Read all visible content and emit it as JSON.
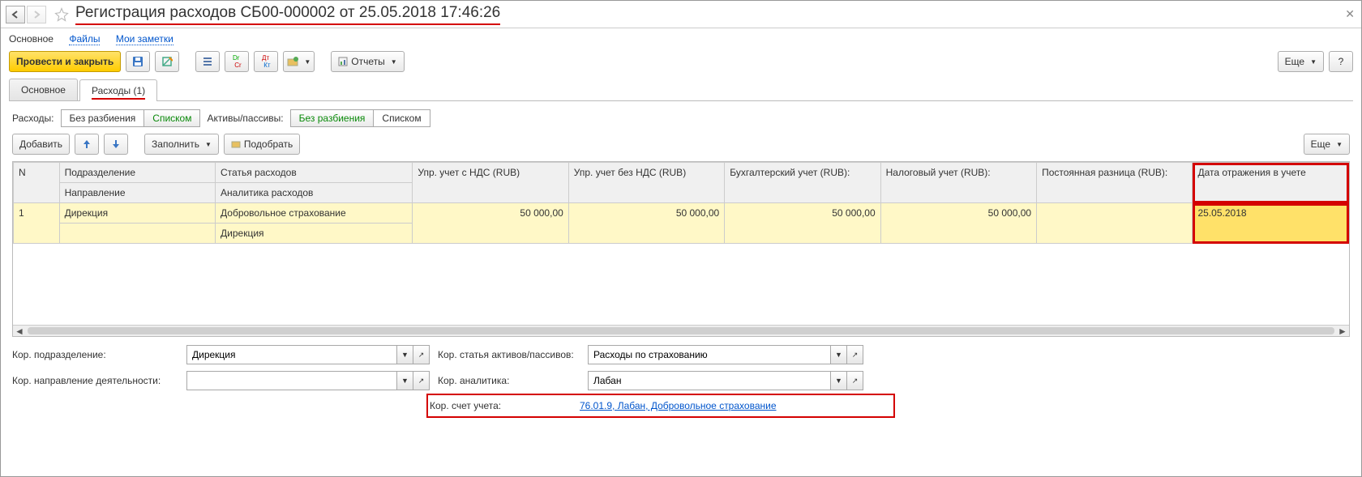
{
  "header": {
    "title": "Регистрация расходов СБ00-000002 от 25.05.2018 17:46:26"
  },
  "navlinks": {
    "main": "Основное",
    "files": "Файлы",
    "notes": "Мои заметки"
  },
  "toolbar": {
    "post_close": "Провести и закрыть",
    "reports": "Отчеты",
    "more": "Еще"
  },
  "tabs": {
    "main": "Основное",
    "expenses": "Расходы (1)"
  },
  "filters": {
    "label_expenses": "Расходы:",
    "no_split": "Без разбиения",
    "list": "Списком",
    "label_assets": "Активы/пассивы:"
  },
  "tbl_toolbar": {
    "add": "Добавить",
    "fill": "Заполнить",
    "pick": "Подобрать",
    "more": "Еще"
  },
  "columns": {
    "n": "N",
    "subdivision": "Подразделение",
    "direction": "Направление",
    "article": "Статья расходов",
    "analytics": "Аналитика расходов",
    "mgmt_vat": "Упр. учет с НДС (RUB)",
    "mgmt_novat": "Упр. учет без НДС (RUB)",
    "acc": "Бухгалтерский учет (RUB):",
    "tax": "Налоговый учет (RUB):",
    "perm_diff": "Постоянная разница (RUB):",
    "date": "Дата отражения в учете"
  },
  "row": {
    "n": "1",
    "subdivision": "Дирекция",
    "direction": "",
    "article": "Добровольное страхование",
    "analytics": "Дирекция",
    "mgmt_vat": "50 000,00",
    "mgmt_novat": "50 000,00",
    "acc": "50 000,00",
    "tax": "50 000,00",
    "perm_diff": "",
    "date": "25.05.2018"
  },
  "bottom": {
    "corr_sub_label": "Кор. подразделение:",
    "corr_sub_value": "Дирекция",
    "corr_art_label": "Кор. статья активов/пассивов:",
    "corr_art_value": "Расходы по страхованию",
    "corr_dir_label": "Кор. направление деятельности:",
    "corr_dir_value": "",
    "corr_anal_label": "Кор. аналитика:",
    "corr_anal_value": "Лабан",
    "corr_account_label": "Кор. счет учета:",
    "corr_account_value": "76.01.9, Лабан, Добровольное страхование"
  }
}
